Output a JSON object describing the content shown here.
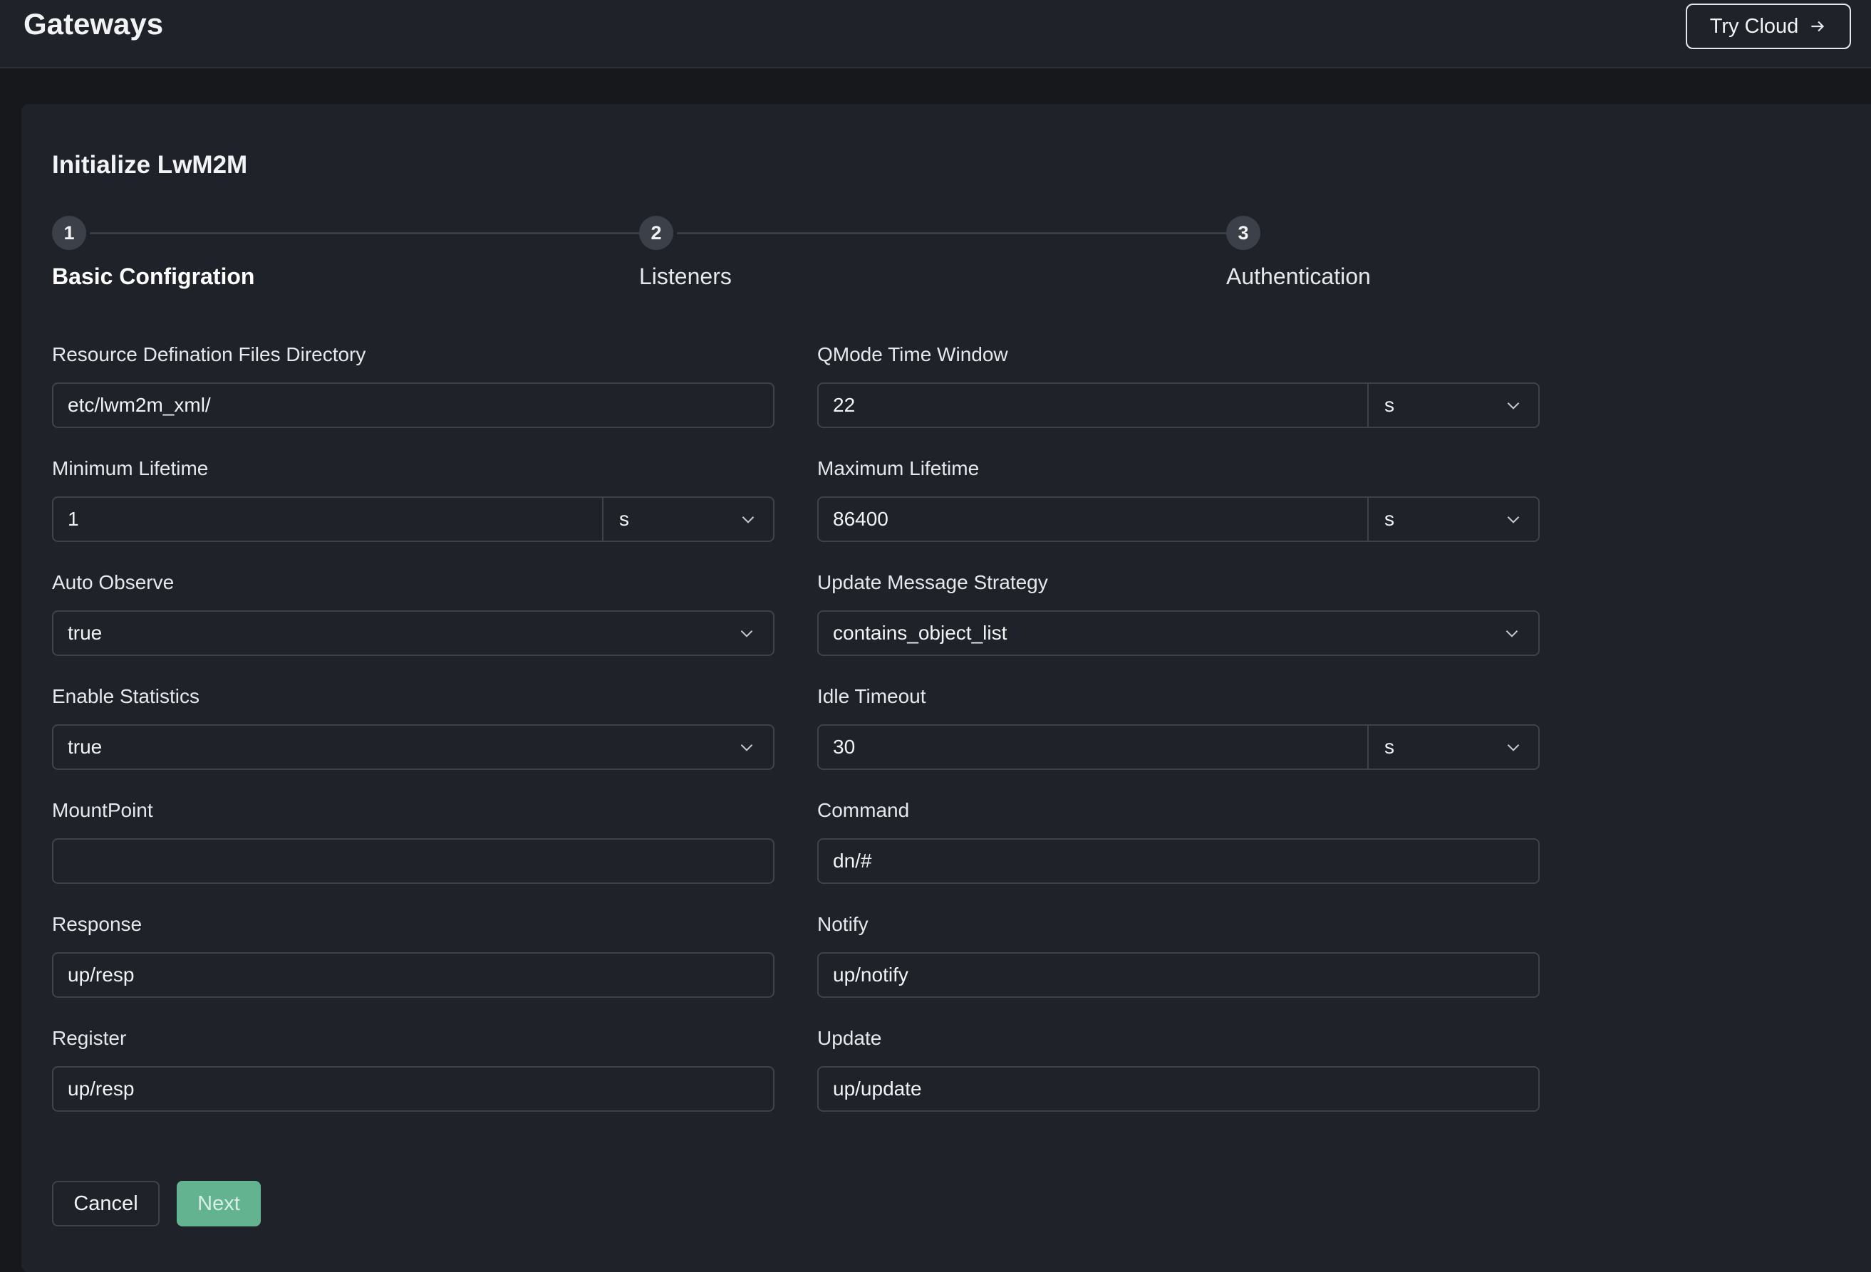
{
  "header": {
    "title": "Gateways",
    "try_cloud_label": "Try Cloud"
  },
  "form": {
    "title": "Initialize LwM2M",
    "steps": [
      {
        "number": "1",
        "label": "Basic Configration",
        "active": true
      },
      {
        "number": "2",
        "label": "Listeners",
        "active": false
      },
      {
        "number": "3",
        "label": "Authentication",
        "active": false
      }
    ],
    "fields": {
      "resource_dir": {
        "label": "Resource Defination Files Directory",
        "value": "etc/lwm2m_xml/"
      },
      "qmode_window": {
        "label": "QMode Time Window",
        "value": "22",
        "unit": "s"
      },
      "min_lifetime": {
        "label": "Minimum Lifetime",
        "value": "1",
        "unit": "s"
      },
      "max_lifetime": {
        "label": "Maximum Lifetime",
        "value": "86400",
        "unit": "s"
      },
      "auto_observe": {
        "label": "Auto Observe",
        "value": "true"
      },
      "update_strategy": {
        "label": "Update Message Strategy",
        "value": "contains_object_list"
      },
      "enable_stats": {
        "label": "Enable Statistics",
        "value": "true"
      },
      "idle_timeout": {
        "label": "Idle Timeout",
        "value": "30",
        "unit": "s"
      },
      "mountpoint": {
        "label": "MountPoint",
        "value": ""
      },
      "command": {
        "label": "Command",
        "value": "dn/#"
      },
      "response": {
        "label": "Response",
        "value": "up/resp"
      },
      "notify": {
        "label": "Notify",
        "value": "up/notify"
      },
      "register": {
        "label": "Register",
        "value": "up/resp"
      },
      "update": {
        "label": "Update",
        "value": "up/update"
      }
    },
    "buttons": {
      "cancel": "Cancel",
      "next": "Next"
    }
  },
  "colors": {
    "background": "#16181c",
    "card": "#1f2229",
    "border": "#3e424a",
    "accent": "#63b390"
  }
}
